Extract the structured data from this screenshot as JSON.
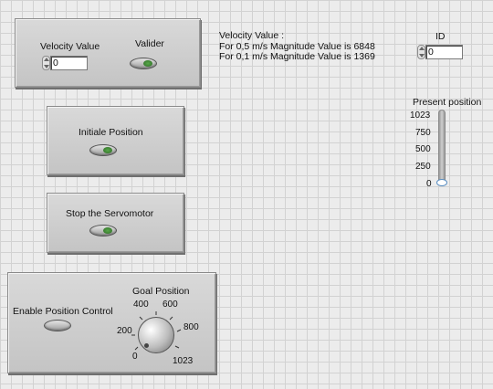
{
  "velocity_panel": {
    "velocity_label": "Velocity Value",
    "velocity_value": "0",
    "valider_label": "Valider"
  },
  "info": {
    "line1": "Velocity Value :",
    "line2": "For 0,5 m/s Magnitude Value is 6848",
    "line3": "For 0,1 m/s Magnitude Value is  1369"
  },
  "id_control": {
    "label": "ID",
    "value": "0"
  },
  "initial_panel": {
    "label": "Initiale Position"
  },
  "stop_panel": {
    "label": "Stop the Servomotor"
  },
  "goal_panel": {
    "enable_label": "Enable Position Control",
    "goal_label": "Goal Position",
    "knob_ticks": [
      "0",
      "200",
      "400",
      "600",
      "800",
      "1023"
    ],
    "knob_value": 0
  },
  "present_position": {
    "label": "Present position",
    "ticks": [
      "1023",
      "750",
      "500",
      "250",
      "0"
    ],
    "value": 0
  },
  "colors": {
    "led_on": "#3d8a34",
    "panel": "#cfcfcf",
    "thumb_border": "#5b8fc2"
  }
}
